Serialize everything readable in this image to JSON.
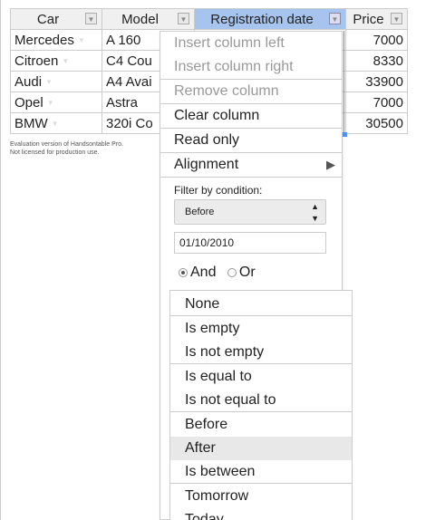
{
  "grid": {
    "headers": [
      "Car",
      "Model",
      "Registration date",
      "Price"
    ],
    "rows": [
      [
        "Mercedes",
        "A 160",
        "7000"
      ],
      [
        "Citroen",
        "C4 Cou",
        "8330"
      ],
      [
        "Audi",
        "A4 Avai",
        "33900"
      ],
      [
        "Opel",
        "Astra",
        "7000"
      ],
      [
        "BMW",
        "320i Co",
        "30500"
      ]
    ]
  },
  "license": {
    "line1": "Evaluation version of Handsontable Pro.",
    "line2": "Not licensed for production use."
  },
  "context_menu": {
    "insert_left": "Insert column left",
    "insert_right": "Insert column right",
    "remove_column": "Remove column",
    "clear_column": "Clear column",
    "read_only": "Read only",
    "alignment": "Alignment",
    "filter_label": "Filter by condition:",
    "condition_value": "Before",
    "date_value": "01/10/2010",
    "and_label": "And",
    "or_label": "Or"
  },
  "condition_dropdown": {
    "items": [
      "None",
      "Is empty",
      "Is not empty",
      "Is equal to",
      "Is not equal to",
      "Before",
      "After",
      "Is between",
      "Tomorrow",
      "Today"
    ],
    "highlighted": "After"
  },
  "colors": {
    "selected_header": "#a6c4ed",
    "selection_border": "#5292f7",
    "highlight_row": "#e8e8e8"
  }
}
